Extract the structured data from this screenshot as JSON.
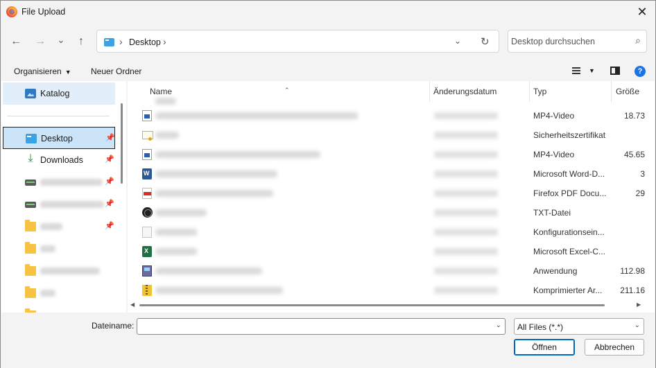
{
  "window": {
    "title": "File Upload",
    "close_glyph": "✕"
  },
  "nav": {
    "back_glyph": "←",
    "forward_glyph": "→",
    "recent_glyph": "⌄",
    "up_glyph": "↑",
    "breadcrumb": [
      "Desktop"
    ],
    "separator": "›",
    "dropdown_glyph": "⌄",
    "refresh_glyph": "↻"
  },
  "search": {
    "placeholder": "Desktop durchsuchen",
    "icon_glyph": "⌕"
  },
  "toolbar": {
    "organize_label": "Organisieren",
    "new_folder_label": "Neuer Ordner",
    "caret": "▼",
    "help_label": "?"
  },
  "sidebar": {
    "items": [
      {
        "label": "Katalog",
        "icon": "gallery-icon"
      },
      {
        "label": "Desktop",
        "icon": "desktop-drive-icon",
        "pinned": true
      },
      {
        "label": "Downloads",
        "icon": "download-icon",
        "pinned": true
      }
    ],
    "pin_glyph": "📌",
    "download_glyph": "⤓"
  },
  "columns": {
    "name": "Name",
    "modified": "Änderungsdatum",
    "type": "Typ",
    "size": "Größe",
    "sort_glyph": "⌃"
  },
  "files": [
    {
      "icon": "video-file-icon",
      "type": "MP4-Video",
      "size": "18.73"
    },
    {
      "icon": "certificate-file-icon",
      "type": "Sicherheitszertifikat",
      "size": ""
    },
    {
      "icon": "video-file-icon",
      "type": "MP4-Video",
      "size": "45.65"
    },
    {
      "icon": "word-file-icon",
      "type": "Microsoft Word-D...",
      "size": "3"
    },
    {
      "icon": "pdf-file-icon",
      "type": "Firefox PDF Docu...",
      "size": "29"
    },
    {
      "icon": "text-file-icon",
      "type": "TXT-Datei",
      "size": ""
    },
    {
      "icon": "config-file-icon",
      "type": "Konfigurationsein...",
      "size": ""
    },
    {
      "icon": "excel-file-icon",
      "type": "Microsoft Excel-C...",
      "size": ""
    },
    {
      "icon": "application-file-icon",
      "type": "Anwendung",
      "size": "112.98"
    },
    {
      "icon": "zip-file-icon",
      "type": "Komprimierter Ar...",
      "size": "211.16"
    }
  ],
  "footer": {
    "filename_label": "Dateiname:",
    "filename_value": "",
    "filter_value": "All Files (*.*)",
    "dropdown_glyph": "⌄",
    "open_label": "Öffnen",
    "cancel_label": "Abbrechen"
  },
  "scroll": {
    "left_glyph": "◀",
    "right_glyph": "▶"
  }
}
